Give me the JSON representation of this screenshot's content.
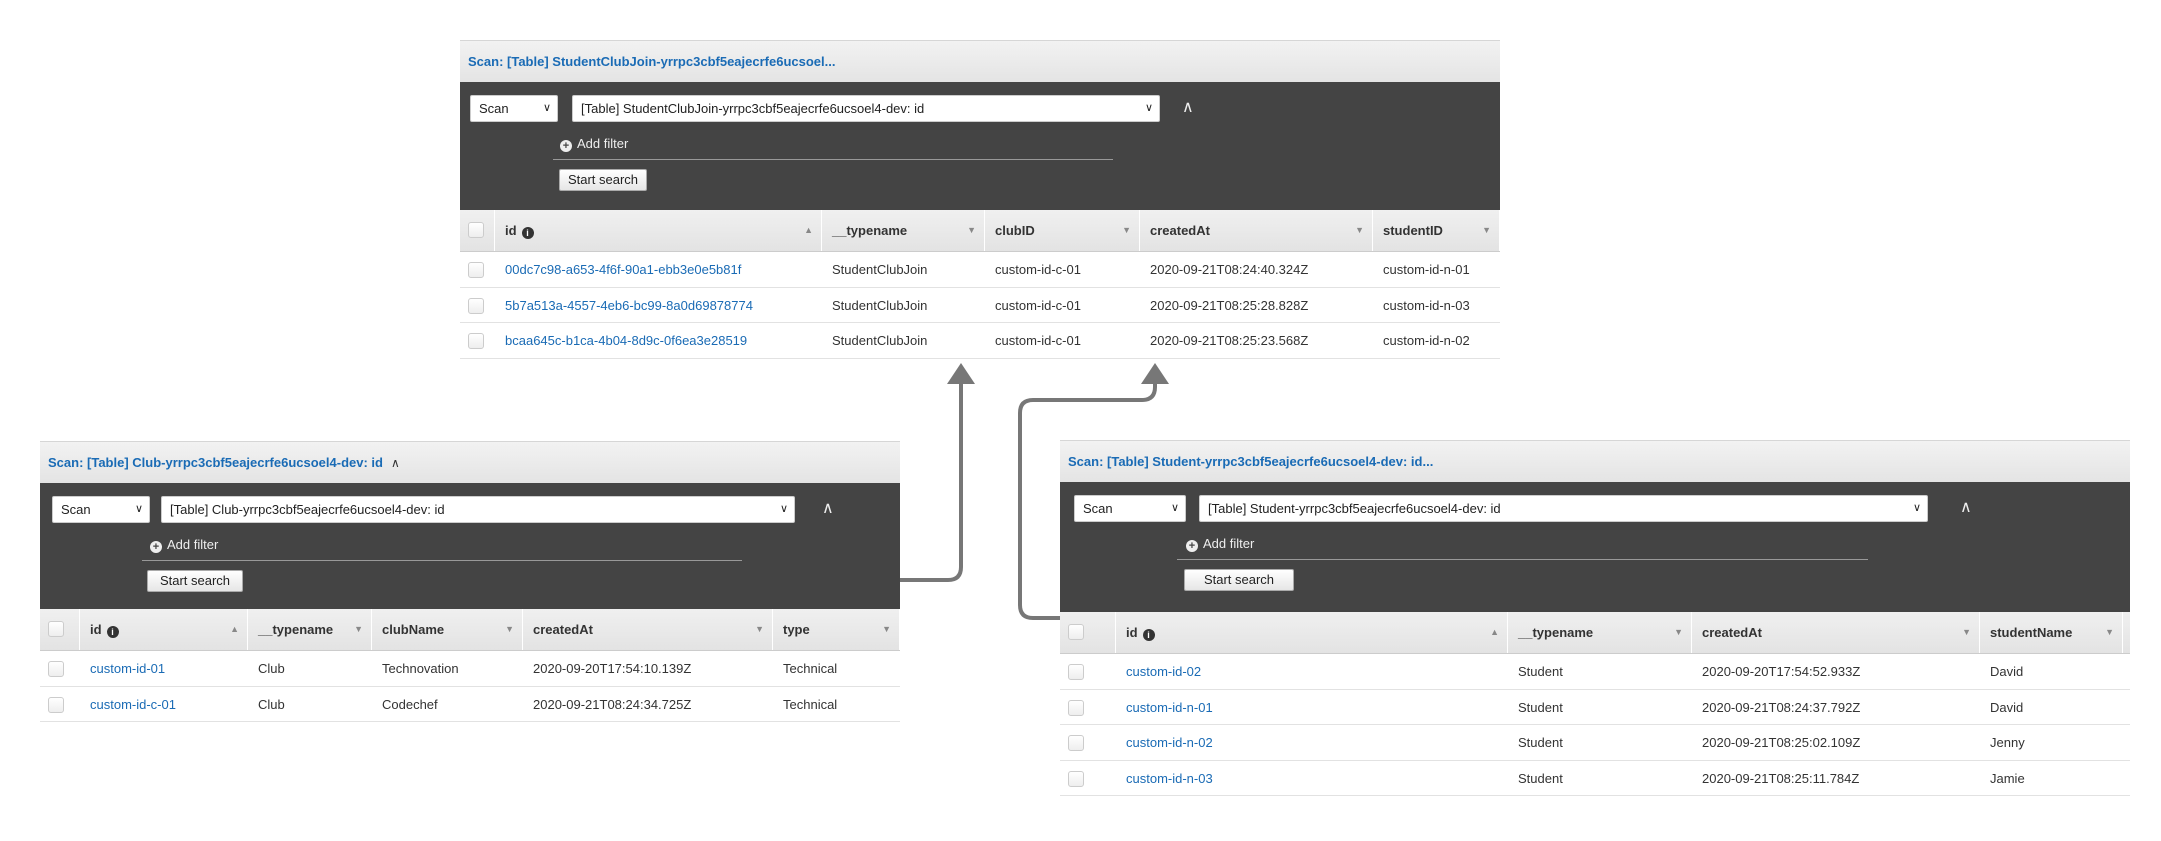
{
  "panels": [
    {
      "id": "student-club-join",
      "title": "Scan: [Table] StudentClubJoin-yrrpc3cbf5eajecrfe6ucsoel...",
      "title_caret": false,
      "mode": "Scan",
      "table_select": "[Table] StudentClubJoin-yrrpc3cbf5eajecrfe6ucsoel4-dev: id",
      "add_filter": "Add filter",
      "start_search": "Start search",
      "columns": [
        "id",
        "__typename",
        "clubID",
        "createdAt",
        "studentID"
      ],
      "rows": [
        [
          "00dc7c98-a653-4f6f-90a1-ebb3e0e5b81f",
          "StudentClubJoin",
          "custom-id-c-01",
          "2020-09-21T08:24:40.324Z",
          "custom-id-n-01"
        ],
        [
          "5b7a513a-4557-4eb6-bc99-8a0d69878774",
          "StudentClubJoin",
          "custom-id-c-01",
          "2020-09-21T08:25:28.828Z",
          "custom-id-n-03"
        ],
        [
          "bcaa645c-b1ca-4b04-8d9c-0f6ea3e28519",
          "StudentClubJoin",
          "custom-id-c-01",
          "2020-09-21T08:25:23.568Z",
          "custom-id-n-02"
        ]
      ]
    },
    {
      "id": "club",
      "title": "Scan: [Table] Club-yrrpc3cbf5eajecrfe6ucsoel4-dev: id",
      "title_caret": true,
      "mode": "Scan",
      "table_select": "[Table] Club-yrrpc3cbf5eajecrfe6ucsoel4-dev: id",
      "add_filter": "Add filter",
      "start_search": "Start search",
      "columns": [
        "id",
        "__typename",
        "clubName",
        "createdAt",
        "type"
      ],
      "rows": [
        [
          "custom-id-01",
          "Club",
          "Technovation",
          "2020-09-20T17:54:10.139Z",
          "Technical"
        ],
        [
          "custom-id-c-01",
          "Club",
          "Codechef",
          "2020-09-21T08:24:34.725Z",
          "Technical"
        ]
      ]
    },
    {
      "id": "student",
      "title": "Scan: [Table] Student-yrrpc3cbf5eajecrfe6ucsoel4-dev: id...",
      "title_caret": false,
      "mode": "Scan",
      "table_select": "[Table] Student-yrrpc3cbf5eajecrfe6ucsoel4-dev: id",
      "add_filter": "Add filter",
      "start_search": "Start search",
      "columns": [
        "id",
        "__typename",
        "createdAt",
        "studentName"
      ],
      "rows": [
        [
          "custom-id-02",
          "Student",
          "2020-09-20T17:54:52.933Z",
          "David"
        ],
        [
          "custom-id-n-01",
          "Student",
          "2020-09-21T08:24:37.792Z",
          "David"
        ],
        [
          "custom-id-n-02",
          "Student",
          "2020-09-21T08:25:02.109Z",
          "Jenny"
        ],
        [
          "custom-id-n-03",
          "Student",
          "2020-09-21T08:25:11.784Z",
          "Jamie"
        ]
      ]
    }
  ],
  "icons": {
    "info": "info-icon",
    "add": "plus-circle-icon",
    "collapse": "chevron-up-icon",
    "sort": "sort-icon"
  },
  "colors": {
    "link": "#1a6bb5",
    "toolbar": "#444444",
    "connector": "#777777"
  }
}
